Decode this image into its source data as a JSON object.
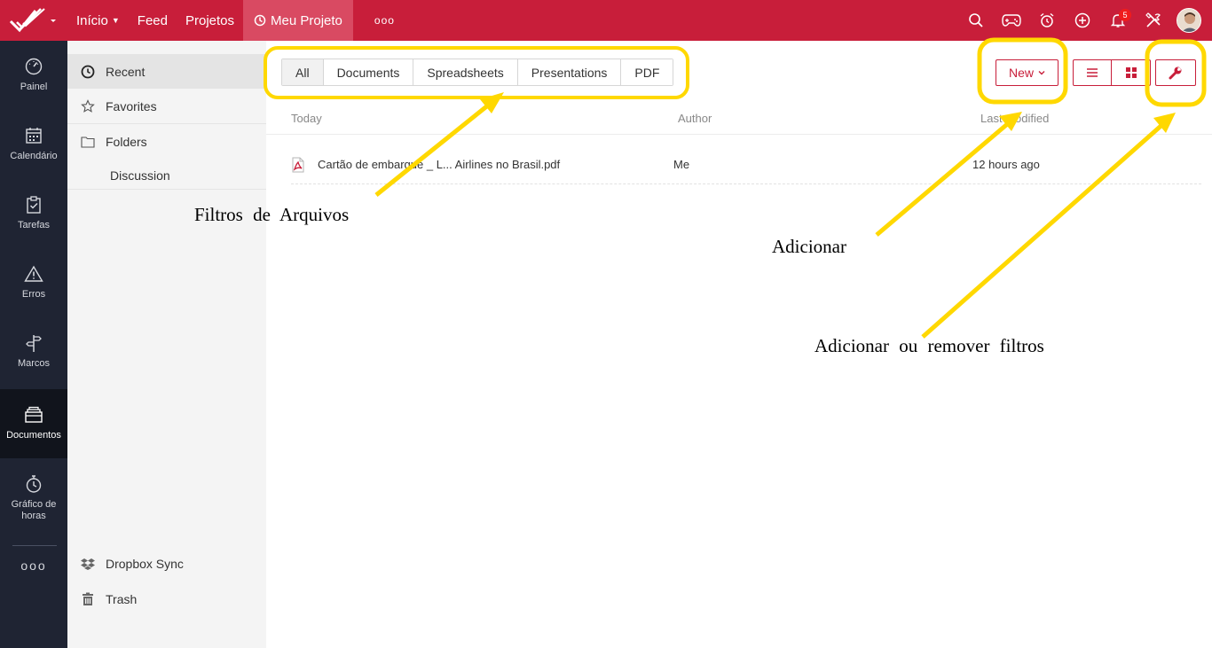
{
  "topbar": {
    "nav": [
      {
        "label": "Início",
        "has_caret": true
      },
      {
        "label": "Feed"
      },
      {
        "label": "Projetos"
      },
      {
        "label": "Meu Projeto",
        "active": true
      },
      {
        "label": "ooo"
      }
    ],
    "notification_count": "5",
    "icons": [
      "search-icon",
      "gamepad-icon",
      "alarm-clock-icon",
      "plus-circle-icon",
      "bell-icon",
      "tools-icon"
    ],
    "brand_color": "#c81e3a"
  },
  "leftbar": {
    "items": [
      {
        "label": "Painel",
        "icon": "dashboard-icon"
      },
      {
        "label": "Calendário",
        "icon": "calendar-icon"
      },
      {
        "label": "Tarefas",
        "icon": "clipboard-check-icon"
      },
      {
        "label": "Erros",
        "icon": "warning-icon"
      },
      {
        "label": "Marcos",
        "icon": "signpost-icon"
      },
      {
        "label": "Documentos",
        "icon": "documents-icon",
        "active": true
      },
      {
        "label": "Gráfico de horas",
        "icon": "stopwatch-icon"
      }
    ],
    "more": "ooo"
  },
  "sidebar": {
    "items": [
      {
        "label": "Recent",
        "icon": "clock-icon",
        "active": true
      },
      {
        "label": "Favorites",
        "icon": "star-icon"
      },
      {
        "label": "Folders",
        "icon": "folder-icon"
      },
      {
        "label": "Discussion"
      }
    ],
    "bottom_items": [
      {
        "label": "Dropbox Sync",
        "icon": "dropbox-icon"
      },
      {
        "label": "Trash",
        "icon": "trash-icon"
      }
    ]
  },
  "main": {
    "filters": [
      {
        "label": "All",
        "active": true
      },
      {
        "label": "Documents"
      },
      {
        "label": "Spreadsheets"
      },
      {
        "label": "Presentations"
      },
      {
        "label": "PDF"
      }
    ],
    "new_label": "New",
    "columns": {
      "name": "Today",
      "author": "Author",
      "modified": "Last modified"
    },
    "files": [
      {
        "name": "Cartão de embarque _ L... Airlines no Brasil.pdf",
        "author": "Me",
        "modified": "12 hours ago",
        "icon": "pdf-icon"
      }
    ]
  },
  "annotations": {
    "filters_label": "Filtros de Arquivos",
    "add_label": "Adicionar",
    "tools_label": "Adicionar ou remover filtros",
    "highlight_color": "#ffd800"
  }
}
